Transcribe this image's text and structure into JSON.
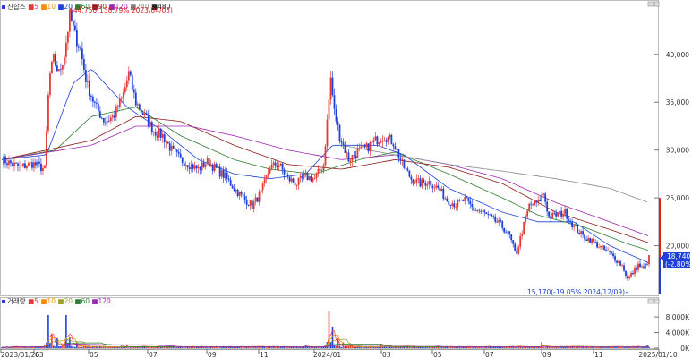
{
  "chart_data": [
    {
      "type": "candlestick",
      "legend": {
        "title": "진합스",
        "items": [
          {
            "label": "5",
            "color": "#e53935"
          },
          {
            "label": "10",
            "color": "#fb8c00"
          },
          {
            "label": "20",
            "color": "#1e40d8"
          },
          {
            "label": "60",
            "color": "#2e7d32"
          },
          {
            "label": "90",
            "color": "#8b1a1a"
          },
          {
            "label": "120",
            "color": "#9c27b0"
          },
          {
            "label": "240",
            "color": "#808080"
          },
          {
            "label": "480",
            "color": "#222222"
          }
        ]
      },
      "y_axis": {
        "ticks": [
          "40,000",
          "35,000",
          "30,000",
          "25,000",
          "20,000"
        ],
        "tick_values": [
          40000,
          35000,
          30000,
          25000,
          20000
        ],
        "ylim": [
          15000,
          45500
        ]
      },
      "x_axis": {
        "ticks": [
          "2023/01/26",
          "'03",
          "'05",
          "'07",
          "'09",
          "'11",
          "2024/01",
          "'03",
          "'05",
          "'07",
          "'09",
          "'11",
          "2025/01/10"
        ]
      },
      "annotations": {
        "high": "44,750(138.79% 2023/04/05)",
        "low": "15,170(-19.05% 2024/12/09)"
      },
      "last_price": {
        "value": "18,740",
        "change": "(-2.80%)",
        "numeric": 18740
      },
      "series": {
        "close_points": [
          [
            0,
            29000
          ],
          [
            20,
            28200
          ],
          [
            35,
            28600
          ],
          [
            48,
            28000
          ],
          [
            53,
            37500
          ],
          [
            58,
            39500
          ],
          [
            64,
            38000
          ],
          [
            70,
            40000
          ],
          [
            76,
            44000
          ],
          [
            82,
            42000
          ],
          [
            88,
            40500
          ],
          [
            95,
            37000
          ],
          [
            105,
            34500
          ],
          [
            115,
            33000
          ],
          [
            125,
            33500
          ],
          [
            135,
            35500
          ],
          [
            142,
            38000
          ],
          [
            150,
            35000
          ],
          [
            160,
            33500
          ],
          [
            170,
            32000
          ],
          [
            180,
            31500
          ],
          [
            190,
            30000
          ],
          [
            200,
            29000
          ],
          [
            210,
            28500
          ],
          [
            220,
            28000
          ],
          [
            230,
            28800
          ],
          [
            240,
            28000
          ],
          [
            250,
            27200
          ],
          [
            260,
            26000
          ],
          [
            270,
            25000
          ],
          [
            280,
            24200
          ],
          [
            290,
            25500
          ],
          [
            300,
            28200
          ],
          [
            310,
            28500
          ],
          [
            320,
            27000
          ],
          [
            330,
            26500
          ],
          [
            340,
            27200
          ],
          [
            350,
            27000
          ],
          [
            360,
            28500
          ],
          [
            368,
            37500
          ],
          [
            372,
            34000
          ],
          [
            378,
            31500
          ],
          [
            388,
            29000
          ],
          [
            398,
            29800
          ],
          [
            408,
            30200
          ],
          [
            418,
            31000
          ],
          [
            428,
            31500
          ],
          [
            438,
            30800
          ],
          [
            448,
            28500
          ],
          [
            458,
            27000
          ],
          [
            468,
            26500
          ],
          [
            478,
            26700
          ],
          [
            488,
            26000
          ],
          [
            498,
            24800
          ],
          [
            508,
            24300
          ],
          [
            518,
            24800
          ],
          [
            528,
            23800
          ],
          [
            538,
            23500
          ],
          [
            548,
            22800
          ],
          [
            558,
            22200
          ],
          [
            568,
            21000
          ],
          [
            575,
            19000
          ],
          [
            582,
            21500
          ],
          [
            590,
            24200
          ],
          [
            600,
            24500
          ],
          [
            606,
            25500
          ],
          [
            612,
            23000
          ],
          [
            620,
            23200
          ],
          [
            630,
            23500
          ],
          [
            640,
            22000
          ],
          [
            650,
            21000
          ],
          [
            660,
            20500
          ],
          [
            670,
            19800
          ],
          [
            680,
            19200
          ],
          [
            688,
            18500
          ],
          [
            695,
            17800
          ],
          [
            700,
            16500
          ],
          [
            706,
            17200
          ],
          [
            712,
            18000
          ],
          [
            718,
            17500
          ],
          [
            724,
            18740
          ]
        ],
        "ma20": [
          [
            0,
            29000
          ],
          [
            50,
            29500
          ],
          [
            80,
            37000
          ],
          [
            100,
            38500
          ],
          [
            140,
            34500
          ],
          [
            180,
            32000
          ],
          [
            220,
            29000
          ],
          [
            260,
            27500
          ],
          [
            300,
            27000
          ],
          [
            340,
            27500
          ],
          [
            370,
            30500
          ],
          [
            420,
            30500
          ],
          [
            450,
            29500
          ],
          [
            500,
            26000
          ],
          [
            560,
            23500
          ],
          [
            600,
            22500
          ],
          [
            640,
            22500
          ],
          [
            680,
            20000
          ],
          [
            724,
            18200
          ]
        ],
        "ma60": [
          [
            0,
            29000
          ],
          [
            60,
            30000
          ],
          [
            100,
            33500
          ],
          [
            150,
            34500
          ],
          [
            200,
            31500
          ],
          [
            260,
            29000
          ],
          [
            300,
            28000
          ],
          [
            350,
            27500
          ],
          [
            400,
            29000
          ],
          [
            440,
            29800
          ],
          [
            500,
            27500
          ],
          [
            560,
            25000
          ],
          [
            600,
            23200
          ],
          [
            650,
            22000
          ],
          [
            700,
            20200
          ],
          [
            724,
            19500
          ]
        ],
        "ma90": [
          [
            0,
            29000
          ],
          [
            100,
            31000
          ],
          [
            150,
            33500
          ],
          [
            200,
            33000
          ],
          [
            260,
            30500
          ],
          [
            320,
            28500
          ],
          [
            380,
            28000
          ],
          [
            440,
            29000
          ],
          [
            500,
            28200
          ],
          [
            560,
            26500
          ],
          [
            620,
            23500
          ],
          [
            680,
            21700
          ],
          [
            724,
            20300
          ]
        ],
        "ma120": [
          [
            0,
            29000
          ],
          [
            100,
            30500
          ],
          [
            150,
            32500
          ],
          [
            210,
            32500
          ],
          [
            260,
            31500
          ],
          [
            320,
            30000
          ],
          [
            380,
            29000
          ],
          [
            440,
            29500
          ],
          [
            500,
            28500
          ],
          [
            560,
            27000
          ],
          [
            620,
            24500
          ],
          [
            680,
            22500
          ],
          [
            724,
            21000
          ]
        ],
        "ma240": [
          [
            380,
            30500
          ],
          [
            440,
            29500
          ],
          [
            500,
            28500
          ],
          [
            560,
            27800
          ],
          [
            620,
            27000
          ],
          [
            680,
            26000
          ],
          [
            724,
            24500
          ]
        ]
      }
    },
    {
      "type": "bar",
      "legend": {
        "title": "거래량",
        "items": [
          {
            "label": "5",
            "color": "#e53935"
          },
          {
            "label": "10",
            "color": "#fb8c00"
          },
          {
            "label": "20",
            "color": "#9e9e2a"
          },
          {
            "label": "60",
            "color": "#2e7d32"
          },
          {
            "label": "120",
            "color": "#9c27b0"
          }
        ]
      },
      "y_axis": {
        "ticks": [
          "8,000K",
          "4,000K",
          "0K"
        ],
        "tick_values": [
          8000,
          4000,
          0
        ],
        "ylim": [
          0,
          11000
        ]
      },
      "spikes": [
        [
          52,
          8500
        ],
        [
          56,
          3500
        ],
        [
          62,
          2500
        ],
        [
          72,
          8500
        ],
        [
          76,
          3000
        ],
        [
          84,
          1500
        ],
        [
          140,
          700
        ],
        [
          200,
          500
        ],
        [
          240,
          500
        ],
        [
          300,
          500
        ],
        [
          340,
          700
        ],
        [
          366,
          9500
        ],
        [
          370,
          5500
        ],
        [
          376,
          2500
        ],
        [
          382,
          1500
        ],
        [
          424,
          1000
        ],
        [
          460,
          500
        ],
        [
          580,
          600
        ],
        [
          604,
          1500
        ],
        [
          640,
          500
        ],
        [
          700,
          500
        ],
        [
          722,
          800
        ]
      ],
      "baseline_volume": 350
    }
  ]
}
